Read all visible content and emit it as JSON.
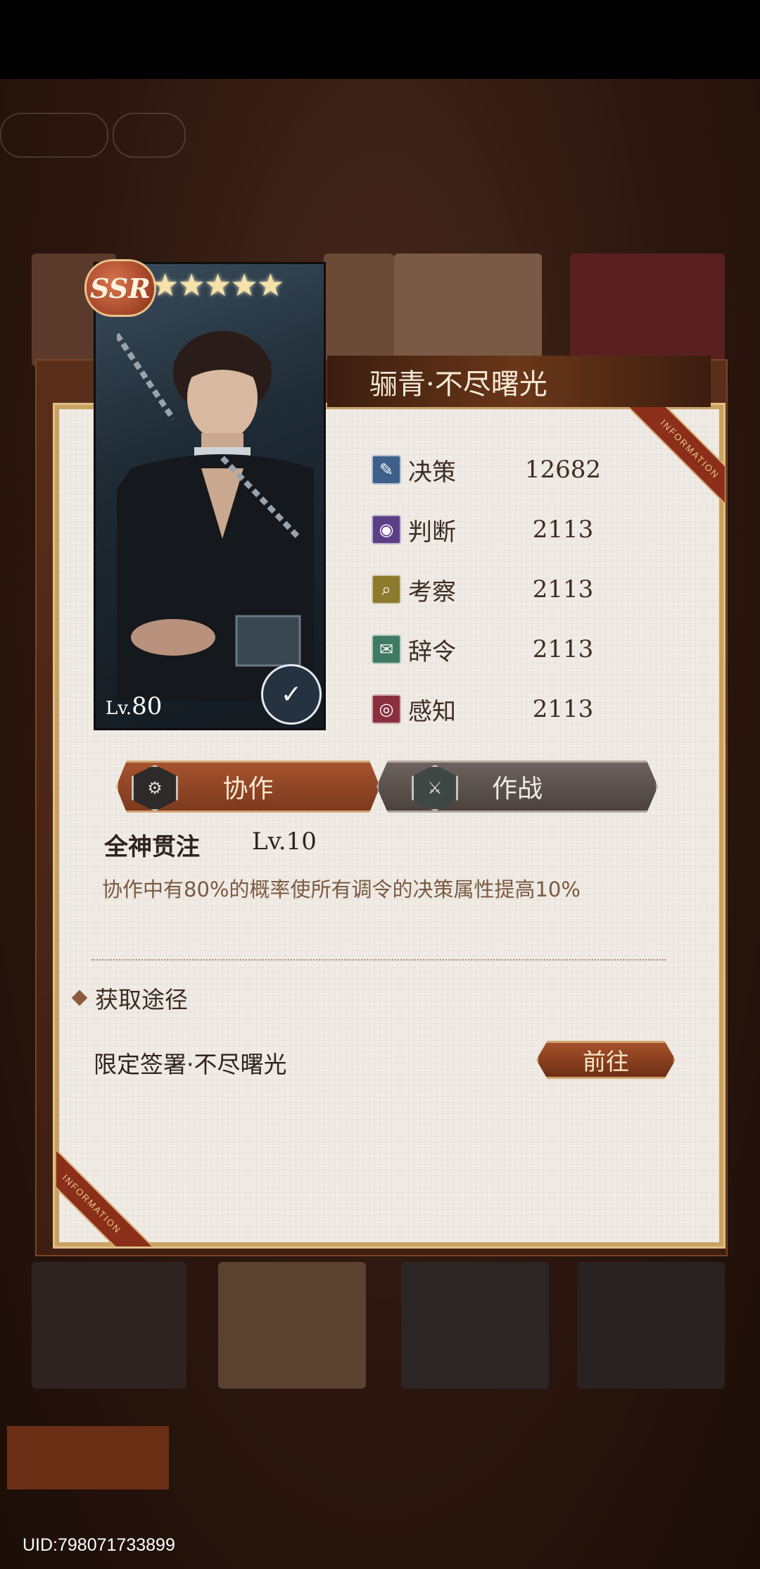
{
  "card": {
    "rarity": "SSR",
    "stars": "★★★★★",
    "level_prefix": "Lv.",
    "level": "80"
  },
  "title": "骊青·不尽曙光",
  "ribbon_text": "INFORMATION",
  "stats": [
    {
      "name": "决策",
      "value": "12682",
      "icon": "decision-icon",
      "color": "#3d5f8a"
    },
    {
      "name": "判断",
      "value": "2113",
      "icon": "judgment-icon",
      "color": "#5b3f86"
    },
    {
      "name": "考察",
      "value": "2113",
      "icon": "inspection-icon",
      "color": "#8c7a2d"
    },
    {
      "name": "辞令",
      "value": "2113",
      "icon": "rhetoric-icon",
      "color": "#3f7a63"
    },
    {
      "name": "感知",
      "value": "2113",
      "icon": "perception-icon",
      "color": "#8a2f3f"
    }
  ],
  "tabs": {
    "active": "协作",
    "inactive": "作战"
  },
  "skill": {
    "name": "全神贯注",
    "level": "Lv.10",
    "description": "协作中有80%的概率使所有调令的决策属性提高10%"
  },
  "source": {
    "heading": "获取途径",
    "name": "限定签署·不尽曙光",
    "go_label": "前往"
  },
  "uid": "UID:798071733899"
}
